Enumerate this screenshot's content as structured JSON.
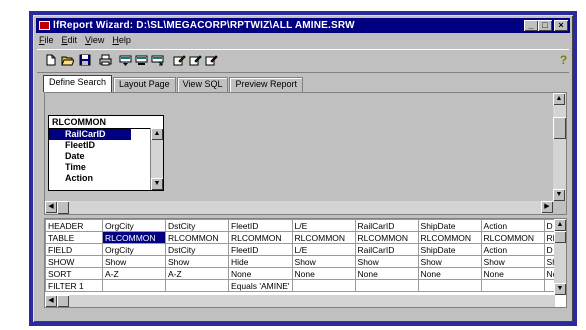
{
  "window": {
    "title": "lfReport Wizard: D:\\SL\\MEGACORP\\RPTWIZ\\ALL AMINE.SRW",
    "controls": {
      "minimize": "_",
      "maximize": "□",
      "close": "×"
    }
  },
  "menu": [
    "File",
    "Edit",
    "View",
    "Help"
  ],
  "toolbar": {
    "icons": [
      "new-icon",
      "open-icon",
      "save-icon",
      "print-icon",
      "query-icon",
      "query-run-icon",
      "query-export-icon",
      "edit-icon",
      "edit-copy-icon",
      "edit-new-icon",
      "help-icon"
    ],
    "help_glyph": "?"
  },
  "tabs": [
    "Define Search",
    "Layout Page",
    "View SQL",
    "Preview Report"
  ],
  "table_list": {
    "header": "RLCOMMON",
    "fields": [
      "RailCarID",
      "FleetID",
      "Date",
      "Time",
      "Action"
    ],
    "selected_index": 0
  },
  "grid": {
    "columns": [
      "HEADER",
      "OrgCity",
      "DstCity",
      "FleetID",
      "L/E",
      "RailCarID",
      "ShipDate",
      "Action",
      "D"
    ],
    "rows": [
      [
        "TABLE",
        "RLCOMMON",
        "RLCOMMON",
        "RLCOMMON",
        "RLCOMMON",
        "RLCOMMON",
        "RLCOMMON",
        "RLCOMMON",
        "RL"
      ],
      [
        "FIELD",
        "OrgCity",
        "DstCity",
        "FleetID",
        "L/E",
        "RailCarID",
        "ShipDate",
        "Action",
        "D"
      ],
      [
        "SHOW",
        "Show",
        "Show",
        "Hide",
        "Show",
        "Show",
        "Show",
        "Show",
        "Sh"
      ],
      [
        "SORT",
        "A-Z",
        "A-Z",
        "None",
        "None",
        "None",
        "None",
        "None",
        "No"
      ],
      [
        "FILTER 1",
        "",
        "",
        "Equals 'AMINE'",
        "",
        "",
        "",
        "",
        ""
      ]
    ],
    "selected_cell": "TABLE.OrgCity"
  },
  "colors": {
    "title_bar": "#000080",
    "selection": "#000080",
    "face": "#c0c0c0",
    "outer_frame": "#2a2a9c"
  }
}
